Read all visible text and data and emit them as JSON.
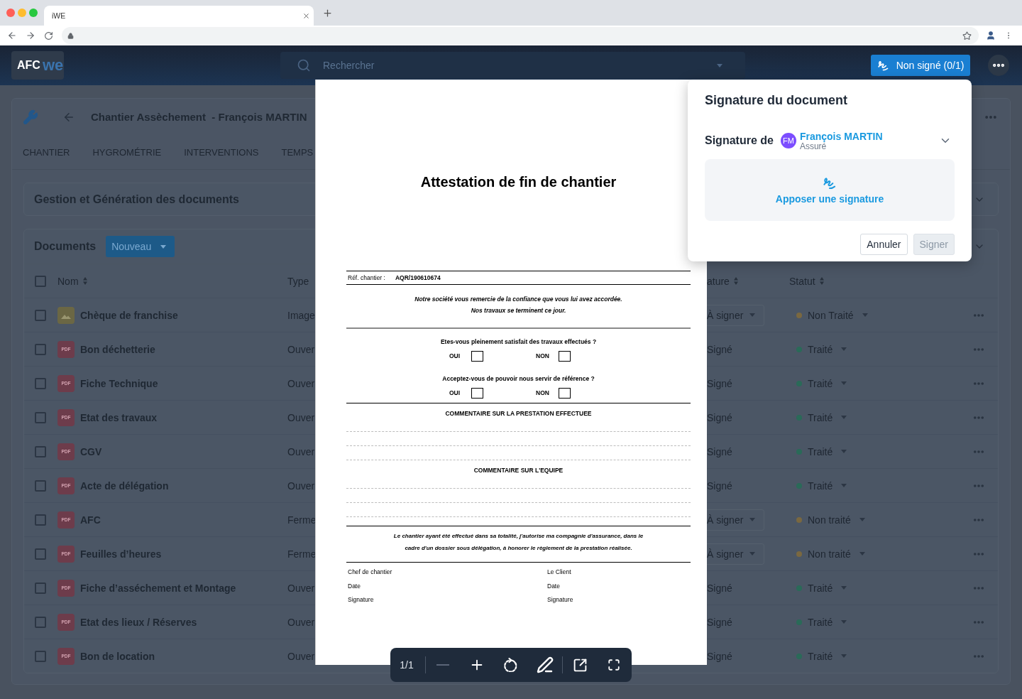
{
  "browser": {
    "tab_title": "iWE"
  },
  "header": {
    "logo": {
      "badge": "AFC",
      "wordmark": "we"
    },
    "search": {
      "placeholder": "Rechercher"
    },
    "sign_status": "Non signé (0/1)"
  },
  "project": {
    "title": "Chantier Assèchement  - François MARTIN",
    "tabs": [
      {
        "label": "CHANTIER",
        "selected": false
      },
      {
        "label": "HYGROMÉTRIE",
        "selected": false
      },
      {
        "label": "INTERVENTIONS",
        "selected": false
      },
      {
        "label": "TEMPS",
        "selected": false
      }
    ]
  },
  "generation_panel": {
    "title": "Gestion et Génération des documents"
  },
  "documents": {
    "title": "Documents",
    "new_button": "Nouveau",
    "all_checked": false,
    "columns": [
      {
        "label": "Nom",
        "sortable": true
      },
      {
        "label": "Type",
        "sortable": false
      },
      {
        "label": "ature",
        "sortable": true
      },
      {
        "label": "Statut",
        "sortable": true
      }
    ],
    "rows": [
      {
        "checked": false,
        "file": {
          "kind": "image"
        },
        "name": "Chèque de franchise",
        "type": "Image",
        "signature": {
          "kind": "select",
          "text": "À signer"
        },
        "status": {
          "text": "Non Traité",
          "color": "#7a6840"
        }
      },
      {
        "checked": false,
        "file": {
          "kind": "pdf",
          "label": "PDF"
        },
        "name": "Bon déchetterie",
        "type": "Ouver",
        "signature": {
          "kind": "plain",
          "text": "Signé"
        },
        "status": {
          "text": "Traité",
          "color": "#2a6a58"
        }
      },
      {
        "checked": false,
        "file": {
          "kind": "pdf",
          "label": "PDF"
        },
        "name": "Fiche Technique",
        "type": "Ouver",
        "signature": {
          "kind": "plain",
          "text": "Signé"
        },
        "status": {
          "text": "Traité",
          "color": "#2a6a58"
        }
      },
      {
        "checked": false,
        "file": {
          "kind": "pdf",
          "label": "PDF"
        },
        "name": "Etat des travaux",
        "type": "Ouver",
        "signature": {
          "kind": "plain",
          "text": "Signé"
        },
        "status": {
          "text": "Traité",
          "color": "#2a6a58"
        }
      },
      {
        "checked": false,
        "file": {
          "kind": "pdf",
          "label": "PDF"
        },
        "name": "CGV",
        "type": "Ouver",
        "signature": {
          "kind": "plain",
          "text": "Signé"
        },
        "status": {
          "text": "Traité",
          "color": "#2a6a58"
        }
      },
      {
        "checked": false,
        "file": {
          "kind": "pdf",
          "label": "PDF"
        },
        "name": "Acte de délégation",
        "type": "Ouver",
        "signature": {
          "kind": "plain",
          "text": "Signé"
        },
        "status": {
          "text": "Traité",
          "color": "#2a6a58"
        }
      },
      {
        "checked": false,
        "file": {
          "kind": "pdf",
          "label": "PDF"
        },
        "name": "AFC",
        "type": "Ferme",
        "signature": {
          "kind": "select",
          "text": "À signer"
        },
        "status": {
          "text": "Non traité",
          "color": "#7a6840"
        }
      },
      {
        "checked": false,
        "file": {
          "kind": "pdf",
          "label": "PDF"
        },
        "name": "Feuilles d’heures",
        "type": "Ferme",
        "signature": {
          "kind": "select",
          "text": "À signer"
        },
        "status": {
          "text": "Non traité",
          "color": "#7a6840"
        }
      },
      {
        "checked": false,
        "file": {
          "kind": "pdf",
          "label": "PDF"
        },
        "name": "Fiche d’asséchement et Montage",
        "type": "Ouver",
        "signature": {
          "kind": "plain",
          "text": "Signé"
        },
        "status": {
          "text": "Traité",
          "color": "#2a6a58"
        }
      },
      {
        "checked": false,
        "file": {
          "kind": "pdf",
          "label": "PDF"
        },
        "name": "Etat des lieux / Réserves",
        "type": "Ouver",
        "signature": {
          "kind": "plain",
          "text": "Signé"
        },
        "status": {
          "text": "Traité",
          "color": "#2a6a58"
        }
      },
      {
        "checked": false,
        "file": {
          "kind": "pdf",
          "label": "PDF"
        },
        "name": "Bon de location",
        "type": "Ouver",
        "signature": {
          "kind": "plain",
          "text": "Signé"
        },
        "status": {
          "text": "Traité",
          "color": "#2a6a58"
        }
      }
    ]
  },
  "viewer": {
    "document": {
      "title": "Attestation de fin de chantier",
      "ref_label": "Réf. chantier :",
      "ref_value": "AQR/190610674",
      "intro": "Notre société vous remercie de la confiance que vous lui avez accordée.\nNos travaux se terminent ce jour.",
      "questions": [
        {
          "text": "Etes-vous pleinement satisfait des travaux effectués ?",
          "options": [
            {
              "label": "OUI",
              "checked": false
            },
            {
              "label": "NON",
              "checked": false
            }
          ]
        },
        {
          "text": "Acceptez-vous de pouvoir nous servir de référence ?",
          "options": [
            {
              "label": "OUI",
              "checked": false
            },
            {
              "label": "NON",
              "checked": false
            }
          ]
        }
      ],
      "comment_sections": [
        {
          "heading": "COMMENTAIRE SUR LA PRESTATION EFFECTUEE"
        },
        {
          "heading": "COMMENTAIRE SUR L'EQUIPE"
        }
      ],
      "authorization": "Le chantier ayant été effectué dans sa totalité, j'autorise ma compagnie d'assurance, dans le\ncadre d'un dossier sous délégation, à honorer le règlement de la prestation réalisée.",
      "signatories": [
        {
          "title": "Chef de chantier",
          "fields": [
            "Date",
            "Signature"
          ]
        },
        {
          "title": "Le Client",
          "fields": [
            "Date",
            "Signature"
          ]
        }
      ]
    },
    "toolbar": {
      "page": "1/1",
      "tool_groups": [
        [
          {
            "kind": "zoom-out",
            "disabled": true
          },
          {
            "kind": "zoom-in",
            "disabled": false
          },
          {
            "kind": "rotate",
            "disabled": false
          },
          {
            "kind": "annotate",
            "disabled": false
          }
        ],
        [
          {
            "kind": "open-external",
            "disabled": false
          },
          {
            "kind": "fullscreen",
            "disabled": false
          }
        ]
      ]
    }
  },
  "popover": {
    "title": "Signature du document",
    "signer_label": "Signature de",
    "signer": {
      "initials": "FM",
      "name": "François MARTIN",
      "role": "Assuré"
    },
    "signature_action": "Apposer une signature",
    "buttons": [
      {
        "label": "Annuler",
        "kind": "secondary",
        "disabled": false
      },
      {
        "label": "Signer",
        "kind": "primary",
        "disabled": true
      }
    ]
  }
}
